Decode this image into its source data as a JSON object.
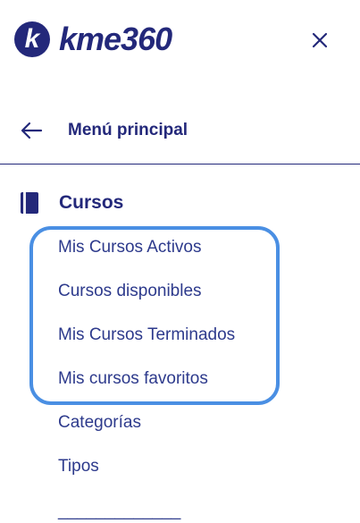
{
  "brand": {
    "logo_letter": "k",
    "name": "kme360",
    "brand_color": "#23287a"
  },
  "header": {
    "close_icon": "close-icon"
  },
  "nav": {
    "back_label": "Menú principal",
    "back_icon": "arrow-left-icon"
  },
  "section": {
    "title": "Cursos",
    "icon": "book-icon"
  },
  "menu": {
    "items": [
      "Mis Cursos Activos",
      "Cursos disponibles",
      "Mis Cursos Terminados",
      "Mis cursos favoritos",
      "Categorías",
      "Tipos"
    ],
    "separator": "_____________"
  },
  "highlight_color": "#4a8fe3"
}
